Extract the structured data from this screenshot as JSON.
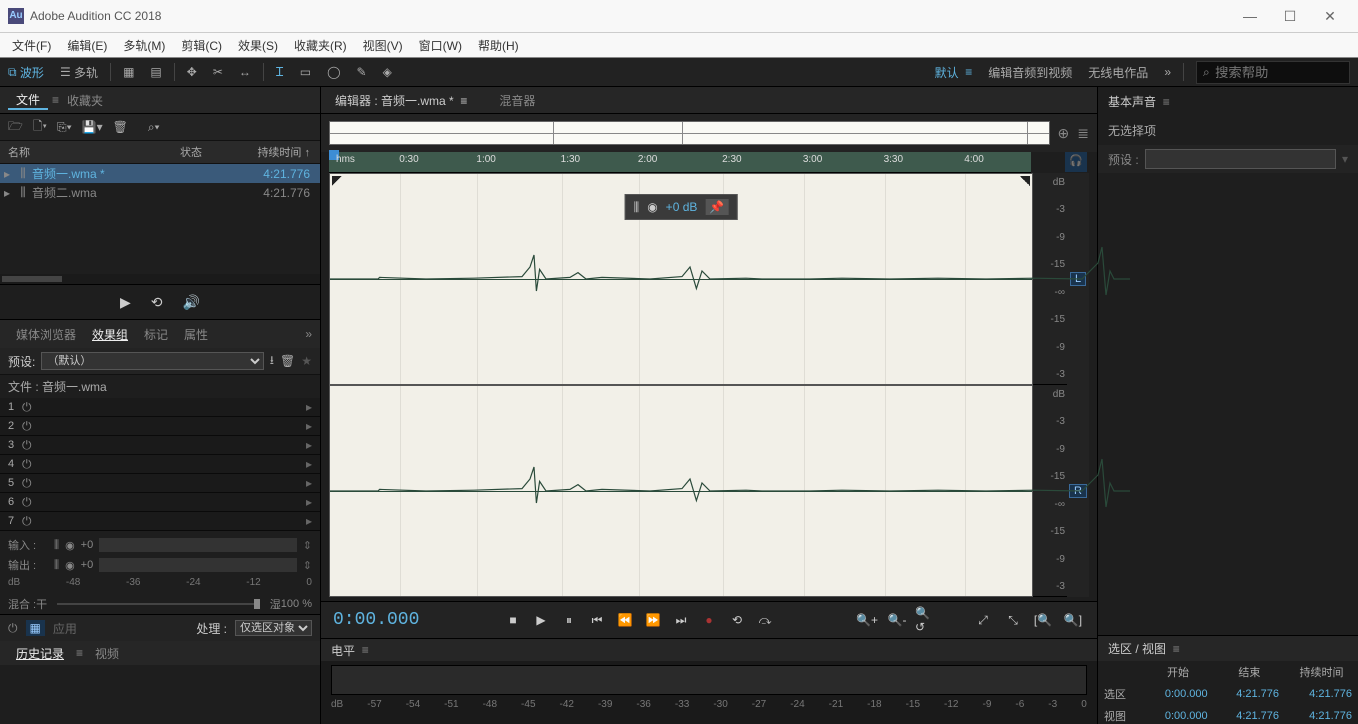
{
  "window": {
    "title": "Adobe Audition CC 2018",
    "logo": "Au"
  },
  "menu": [
    "文件(F)",
    "编辑(E)",
    "多轨(M)",
    "剪辑(C)",
    "效果(S)",
    "收藏夹(R)",
    "视图(V)",
    "窗口(W)",
    "帮助(H)"
  ],
  "toolbar": {
    "waveform": "波形",
    "multitrack": "多轨",
    "default": "默认",
    "editAV": "编辑音频到视频",
    "radio": "无线电作品"
  },
  "search": {
    "placeholder": "搜索帮助"
  },
  "filepanel": {
    "file": "文件",
    "favorites": "收藏夹",
    "colName": "名称",
    "colStatus": "状态",
    "colDur": "持续时间",
    "files": [
      {
        "name": "音频一.wma *",
        "dur": "4:21.776",
        "sel": true
      },
      {
        "name": "音频二.wma",
        "dur": "4:21.776",
        "sel": false
      }
    ]
  },
  "effects": {
    "mediaBrowser": "媒体浏览器",
    "group": "效果组",
    "markers": "标记",
    "props": "属性",
    "presetLbl": "预设:",
    "presetVal": "（默认）",
    "fileLbl": "文件 : 音频一.wma",
    "slots": [
      "1",
      "2",
      "3",
      "4",
      "5",
      "6",
      "7"
    ],
    "inLbl": "输入 :",
    "outLbl": "输出 :",
    "ioDb": "+0",
    "dbScale": [
      "dB",
      "-48",
      "-36",
      "-24",
      "-12",
      "0"
    ],
    "mixLbl": "混合 :",
    "dry": "干",
    "wet": "湿",
    "pct": "100 %",
    "applyBtn": "应用",
    "processLbl": "处理 :",
    "processVal": "仅选区对象"
  },
  "history": {
    "history": "历史记录",
    "video": "视频"
  },
  "editor": {
    "title": "编辑器 : 音频一.wma *",
    "mixer": "混音器",
    "ruler": [
      "hms",
      "0:30",
      "1:00",
      "1:30",
      "2:00",
      "2:30",
      "3:00",
      "3:30",
      "4:00"
    ],
    "hudDb": "+0 dB",
    "dblabels": [
      "dB",
      "-3",
      "-9",
      "-15",
      "-∞",
      "-15",
      "-9",
      "-3"
    ],
    "chL": "L",
    "chR": "R",
    "timecode": "0:00.000"
  },
  "level": {
    "title": "电平",
    "scale": [
      "dB",
      "-57",
      "-54",
      "-51",
      "-48",
      "-45",
      "-42",
      "-39",
      "-36",
      "-33",
      "-30",
      "-27",
      "-24",
      "-21",
      "-18",
      "-15",
      "-12",
      "-9",
      "-6",
      "-3",
      "0"
    ]
  },
  "essential": {
    "title": "基本声音",
    "nosel": "无选择项",
    "preset": "预设 :"
  },
  "selview": {
    "title": "选区 / 视图",
    "start": "开始",
    "end": "结束",
    "dur": "持续时间",
    "selRow": "选区",
    "viewRow": "视图",
    "sel": [
      "0:00.000",
      "4:21.776",
      "4:21.776"
    ],
    "view": [
      "0:00.000",
      "4:21.776",
      "4:21.776"
    ]
  }
}
